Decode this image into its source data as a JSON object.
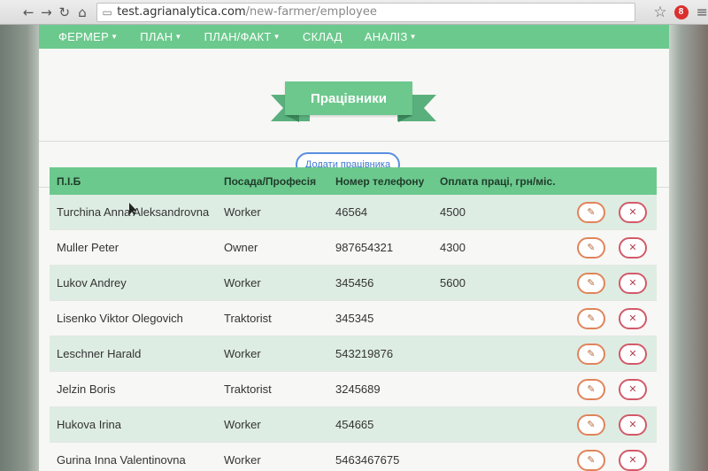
{
  "browser": {
    "url_host": "test.agrianalytica.com",
    "url_path": "/new-farmer/employee",
    "extension_badge": "8"
  },
  "nav": {
    "items": [
      {
        "label": "ФЕРМЕР",
        "dropdown": true
      },
      {
        "label": "ПЛАН",
        "dropdown": true
      },
      {
        "label": "ПЛАН/ФАКТ",
        "dropdown": true
      },
      {
        "label": "СКЛАД",
        "dropdown": false
      },
      {
        "label": "АНАЛІЗ",
        "dropdown": true
      }
    ]
  },
  "page_title": "Працівники",
  "add_button_label": "Додати працівника",
  "table": {
    "headers": [
      "П.І.Б",
      "Посада/Професія",
      "Номер телефону",
      "Оплата праці, грн/міс."
    ],
    "rows": [
      {
        "name": "Turchina Anna Aleksandrovna",
        "position": "Worker",
        "phone": "46564",
        "salary": "4500"
      },
      {
        "name": "Muller Peter",
        "position": "Owner",
        "phone": "987654321",
        "salary": "4300"
      },
      {
        "name": "Lukov Andrey",
        "position": "Worker",
        "phone": "345456",
        "salary": "5600"
      },
      {
        "name": "Lisenko Viktor Olegovich",
        "position": "Traktorist",
        "phone": "345345",
        "salary": ""
      },
      {
        "name": "Leschner Harald",
        "position": "Worker",
        "phone": "543219876",
        "salary": ""
      },
      {
        "name": "Jelzin Boris",
        "position": "Traktorist",
        "phone": "3245689",
        "salary": ""
      },
      {
        "name": "Hukova Irina",
        "position": "Worker",
        "phone": "454665",
        "salary": ""
      },
      {
        "name": "Gurina Inna Valentinovna",
        "position": "Worker",
        "phone": "5463467675",
        "salary": ""
      }
    ]
  },
  "icons": {
    "back": "arrow-left-icon",
    "forward": "arrow-right-icon",
    "reload": "reload-icon",
    "home": "home-icon",
    "star": "star-icon",
    "menu": "hamburger-menu-icon",
    "edit": "pencil-icon",
    "delete": "x-icon"
  },
  "colors": {
    "accent_green": "#6cc98d",
    "row_alt": "#deede3",
    "add_button": "#5a8fe0",
    "edit_button": "#e0845a",
    "delete_button": "#d25a69"
  }
}
